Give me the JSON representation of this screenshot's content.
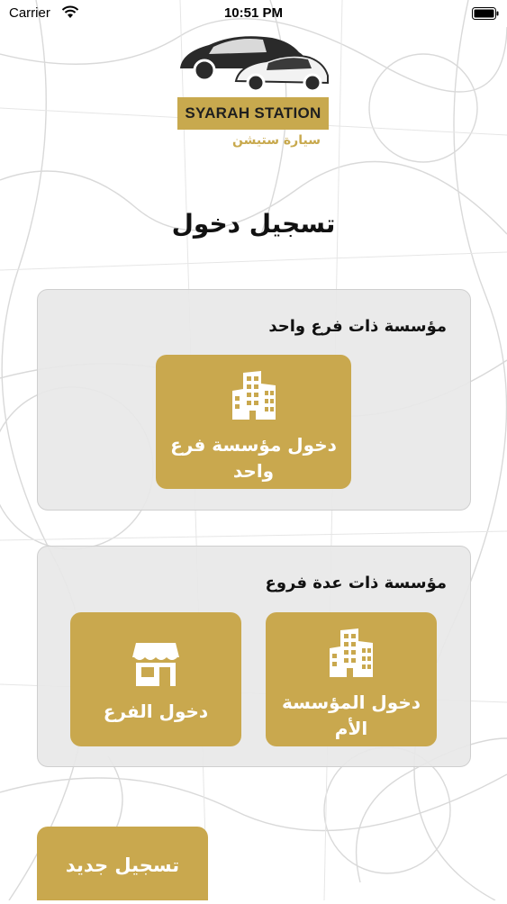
{
  "status_bar": {
    "carrier": "Carrier",
    "time": "10:51 PM",
    "icons": [
      "wifi-icon",
      "battery-icon"
    ]
  },
  "logo": {
    "brand_name": "SYARAH STATION",
    "brand_name_arabic": "سيارة ستيشن"
  },
  "page_title": "تسجيل دخول",
  "single_branch_section": {
    "heading": "مؤسسة ذات فرع واحد",
    "tile": {
      "label": "دخول مؤسسة فرع واحد",
      "icon": "building-icon"
    }
  },
  "multi_branch_section": {
    "heading": "مؤسسة ذات عدة فروع",
    "tiles": [
      {
        "label": "دخول المؤسسة الأم",
        "icon": "building-icon"
      },
      {
        "label": "دخول الفرع",
        "icon": "storefront-icon"
      }
    ]
  },
  "register_button": {
    "label": "تسجيل جديد"
  },
  "colors": {
    "accent": "#c9a84e",
    "card_background": "#e8e8e8",
    "text": "#111111"
  }
}
